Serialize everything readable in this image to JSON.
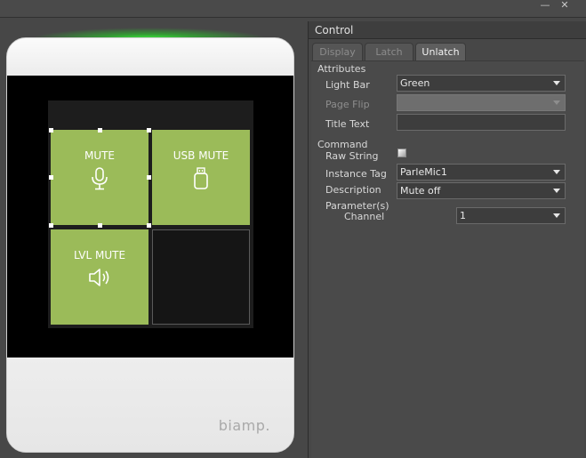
{
  "window": {
    "minimize_glyph": "—",
    "close_glyph": "✕"
  },
  "device": {
    "brand": "biamp."
  },
  "tiles": [
    {
      "label": "MUTE",
      "icon": "microphone-icon"
    },
    {
      "label": "USB MUTE",
      "icon": "usb-icon"
    },
    {
      "label": "LVL MUTE",
      "icon": "speaker-icon"
    },
    {
      "label": "",
      "icon": ""
    }
  ],
  "panel": {
    "title": "Control",
    "tabs": [
      {
        "label": "Display",
        "active": false
      },
      {
        "label": "Latch",
        "active": false
      },
      {
        "label": "Unlatch",
        "active": true
      }
    ],
    "attributes": {
      "heading": "Attributes",
      "light_bar": {
        "label": "Light Bar",
        "value": "Green"
      },
      "page_flip": {
        "label": "Page Flip",
        "value": ""
      },
      "title_text": {
        "label": "Title Text",
        "value": ""
      }
    },
    "command": {
      "heading": "Command",
      "raw_string": {
        "label": "Raw String",
        "checked": false
      },
      "instance_tag": {
        "label": "Instance Tag",
        "value": "ParleMic1"
      },
      "description": {
        "label": "Description",
        "value": "Mute off"
      },
      "parameters": {
        "label": "Parameter(s)"
      },
      "channel": {
        "label": "Channel",
        "value": "1"
      }
    }
  },
  "colors": {
    "tile_green": "#9bbb59",
    "light_bar_glow": "#3cff3c",
    "panel_bg": "#474747"
  }
}
